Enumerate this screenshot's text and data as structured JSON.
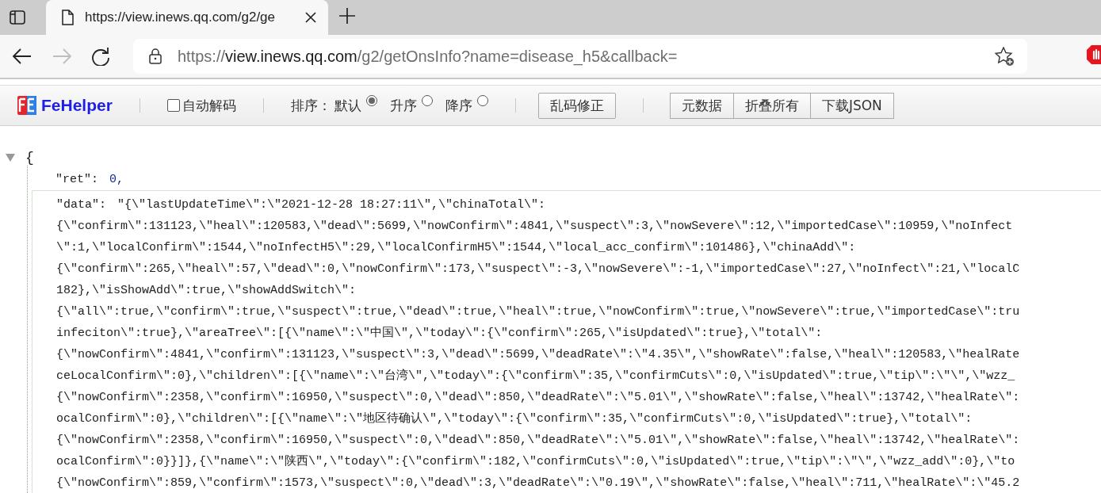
{
  "browser": {
    "tab": {
      "title": "https://view.inews.qq.com/g2/ge"
    },
    "address": {
      "scheme": "https://",
      "host": "view.inews.qq.com",
      "path": "/g2/getOnsInfo?name=disease_h5&callback="
    },
    "forward_disabled": true
  },
  "toolbar": {
    "brand": "FeHelper",
    "auto_decode": {
      "label": "自动解码",
      "checked": false
    },
    "sort": {
      "label": "排序：",
      "options": [
        {
          "label": "默认",
          "selected": true
        },
        {
          "label": "升序",
          "selected": false
        },
        {
          "label": "降序",
          "selected": false
        }
      ]
    },
    "fix_button": "乱码修正",
    "button_group": [
      "元数据",
      "折叠所有",
      "下载JSON"
    ]
  },
  "json_view": {
    "expanded": true,
    "open_brace": "{",
    "ret": {
      "key": "\"ret\":",
      "value": "0,"
    },
    "data": {
      "key": "\"data\":",
      "lines": [
        "\"{\\\"lastUpdateTime\\\":\\\"2021-12-28 18:27:11\\\",\\\"chinaTotal\\\":",
        "{\\\"confirm\\\":131123,\\\"heal\\\":120583,\\\"dead\\\":5699,\\\"nowConfirm\\\":4841,\\\"suspect\\\":3,\\\"nowSevere\\\":12,\\\"importedCase\\\":10959,\\\"noInfect",
        "\\\":1,\\\"localConfirm\\\":1544,\\\"noInfectH5\\\":29,\\\"localConfirmH5\\\":1544,\\\"local_acc_confirm\\\":101486},\\\"chinaAdd\\\":",
        "{\\\"confirm\\\":265,\\\"heal\\\":57,\\\"dead\\\":0,\\\"nowConfirm\\\":173,\\\"suspect\\\":-3,\\\"nowSevere\\\":-1,\\\"importedCase\\\":27,\\\"noInfect\\\":21,\\\"localC",
        "182},\\\"isShowAdd\\\":true,\\\"showAddSwitch\\\":",
        "{\\\"all\\\":true,\\\"confirm\\\":true,\\\"suspect\\\":true,\\\"dead\\\":true,\\\"heal\\\":true,\\\"nowConfirm\\\":true,\\\"nowSevere\\\":true,\\\"importedCase\\\":tru",
        "infeciton\\\":true},\\\"areaTree\\\":[{\\\"name\\\":\\\"中国\\\",\\\"today\\\":{\\\"confirm\\\":265,\\\"isUpdated\\\":true},\\\"total\\\":",
        "{\\\"nowConfirm\\\":4841,\\\"confirm\\\":131123,\\\"suspect\\\":3,\\\"dead\\\":5699,\\\"deadRate\\\":\\\"4.35\\\",\\\"showRate\\\":false,\\\"heal\\\":120583,\\\"healRate",
        "ceLocalConfirm\\\":0},\\\"children\\\":[{\\\"name\\\":\\\"台湾\\\",\\\"today\\\":{\\\"confirm\\\":35,\\\"confirmCuts\\\":0,\\\"isUpdated\\\":true,\\\"tip\\\":\\\"\\\",\\\"wzz_",
        "{\\\"nowConfirm\\\":2358,\\\"confirm\\\":16950,\\\"suspect\\\":0,\\\"dead\\\":850,\\\"deadRate\\\":\\\"5.01\\\",\\\"showRate\\\":false,\\\"heal\\\":13742,\\\"healRate\\\":",
        "ocalConfirm\\\":0},\\\"children\\\":[{\\\"name\\\":\\\"地区待确认\\\",\\\"today\\\":{\\\"confirm\\\":35,\\\"confirmCuts\\\":0,\\\"isUpdated\\\":true},\\\"total\\\":",
        "{\\\"nowConfirm\\\":2358,\\\"confirm\\\":16950,\\\"suspect\\\":0,\\\"dead\\\":850,\\\"deadRate\\\":\\\"5.01\\\",\\\"showRate\\\":false,\\\"heal\\\":13742,\\\"healRate\\\":",
        "ocalConfirm\\\":0}}]},{\\\"name\\\":\\\"陕西\\\",\\\"today\\\":{\\\"confirm\\\":182,\\\"confirmCuts\\\":0,\\\"isUpdated\\\":true,\\\"tip\\\":\\\"\\\",\\\"wzz_add\\\":0},\\\"to",
        "{\\\"nowConfirm\\\":859,\\\"confirm\\\":1573,\\\"suspect\\\":0,\\\"dead\\\":3,\\\"deadRate\\\":\\\"0.19\\\",\\\"showRate\\\":false,\\\"heal\\\":711,\\\"healRate\\\":\\\"45.2"
      ]
    }
  }
}
